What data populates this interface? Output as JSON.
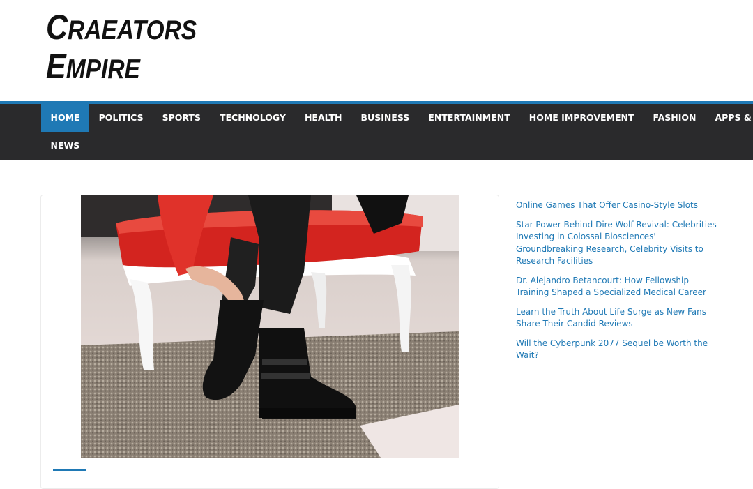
{
  "site": {
    "logo_line1_big": "C",
    "logo_line1_rest": "RAEATORS",
    "logo_line2_big": "E",
    "logo_line2_rest": "MPIRE"
  },
  "nav": {
    "items": [
      {
        "label": "HOME",
        "active": true
      },
      {
        "label": "POLITICS"
      },
      {
        "label": "SPORTS"
      },
      {
        "label": "TECHNOLOGY"
      },
      {
        "label": "HEALTH"
      },
      {
        "label": "BUSINESS"
      },
      {
        "label": "ENTERTAINMENT"
      },
      {
        "label": "HOME IMPROVEMENT"
      },
      {
        "label": "FASHION"
      },
      {
        "label": "APPS & GAMES"
      },
      {
        "label": "NEWS"
      }
    ]
  },
  "sidebar": {
    "recent_posts": [
      "Online Games That Offer Casino-Style Slots",
      "Star Power Behind Dire Wolf Revival: Celebrities Investing in Colossal Biosciences' Groundbreaking Research, Celebrity Visits to Research Facilities",
      "Dr. Alejandro Betancourt: How Fellowship Training Shaped a Specialized Medical Career",
      "Learn the Truth About Life Surge as New Fans Share Their Candid Reviews",
      "Will the Cyberpunk 2077 Sequel be Worth the Wait?"
    ]
  },
  "colors": {
    "accent": "#1f79b5",
    "nav_bg": "#2a2a2c",
    "link": "#1f79b5"
  }
}
